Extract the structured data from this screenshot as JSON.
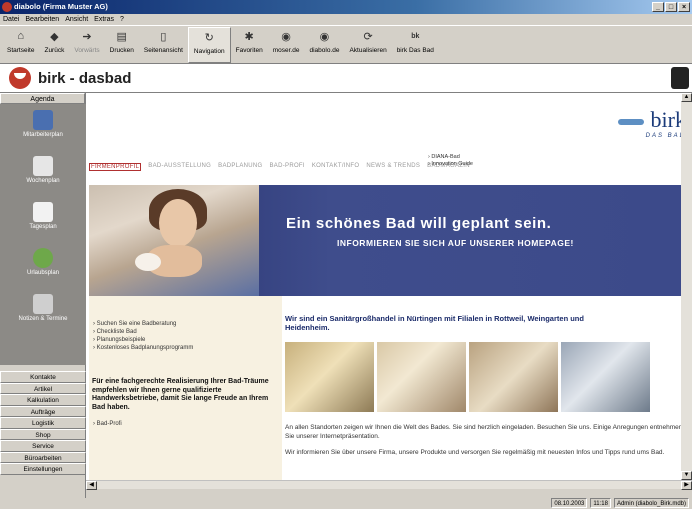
{
  "window": {
    "title": "diabolo (Firma Muster AG)"
  },
  "menu": [
    "Datei",
    "Bearbeiten",
    "Ansicht",
    "Extras",
    "?"
  ],
  "toolbar": [
    {
      "label": "Startseite",
      "icon": "home-icon",
      "glyph": "⌂"
    },
    {
      "label": "Zurück",
      "icon": "back-icon",
      "glyph": "◆"
    },
    {
      "label": "Vorwärts",
      "icon": "forward-icon",
      "glyph": "➔"
    },
    {
      "label": "Drucken",
      "icon": "printer-icon",
      "glyph": "▤"
    },
    {
      "label": "Seitenansicht",
      "icon": "page-preview-icon",
      "glyph": "▯"
    },
    {
      "label": "Navigation",
      "icon": "navigation-icon",
      "glyph": "↻"
    },
    {
      "label": "Favoriten",
      "icon": "favorites-icon",
      "glyph": "✱"
    },
    {
      "label": "moser.de",
      "icon": "web-icon",
      "glyph": "◉"
    },
    {
      "label": "diabolo.de",
      "icon": "web-icon",
      "glyph": "◉"
    },
    {
      "label": "Aktualisieren",
      "icon": "refresh-icon",
      "glyph": "⟳"
    },
    {
      "label": "birk Das Bad",
      "icon": "birk-icon",
      "glyph": "bk"
    }
  ],
  "header": {
    "title": "birk - dasbad"
  },
  "nav": {
    "agenda": "Agenda",
    "agenda_items": [
      "Mitarbeiterplan",
      "Wochenplan",
      "Tagesplan",
      "Urlaubsplan",
      "Notizen & Termine"
    ],
    "buttons": [
      "Kontakte",
      "Artikel",
      "Kalkulation",
      "Aufträge",
      "Logistik",
      "Shop",
      "Service",
      "Büroarbeiten",
      "Einstellungen"
    ]
  },
  "site": {
    "nav": [
      "FIRMENPROFIL",
      "BAD-AUSSTELLUNG",
      "BADPLANUNG",
      "BAD-PROFI",
      "KONTAKT/INFO",
      "NEWS & TRENDS",
      "BADMAGAZIN"
    ],
    "logo": "birk",
    "logo_sub": "DAS BAD",
    "subnav": [
      "› DIANA-Bad",
      "› Innovation Guide"
    ],
    "hero_title": "Ein schönes Bad will geplant sein.",
    "hero_sub": "INFORMIEREN SIE SICH AUF UNSERER HOMEPAGE!",
    "links1": [
      "› Suchen Sie eine Badberatung",
      "› Checkliste Bad",
      "› Planungsbeispiele",
      "› Kostenloses Badplanungsprogramm"
    ],
    "bold_text": "Für eine fachgerechte Realisierung Ihrer Bad-Träume empfehlen wir Ihnen gerne qualifizierte Handwerksbetriebe, damit Sie lange Freude an Ihrem Bad haben.",
    "links2": [
      "› Bad-Profi"
    ],
    "headline": "Wir sind ein Sanitärgroßhandel in Nürtingen mit Filialen in Rottweil, Weingarten und Heidenheim.",
    "para1": "An allen Standorten zeigen wir Ihnen die Welt des Bades. Sie sind herzlich eingeladen. Besuchen Sie uns. Einige Anregungen entnehmen Sie unserer Internetpräsentation.",
    "para2": "Wir informieren Sie über unsere Firma, unsere Produkte und versorgen Sie regelmäßig mit neuesten Infos und Tipps rund ums Bad."
  },
  "status": {
    "date": "08.10.2003",
    "time": "11:18",
    "user": "Admin (diabolo_Birk.mdb)"
  }
}
